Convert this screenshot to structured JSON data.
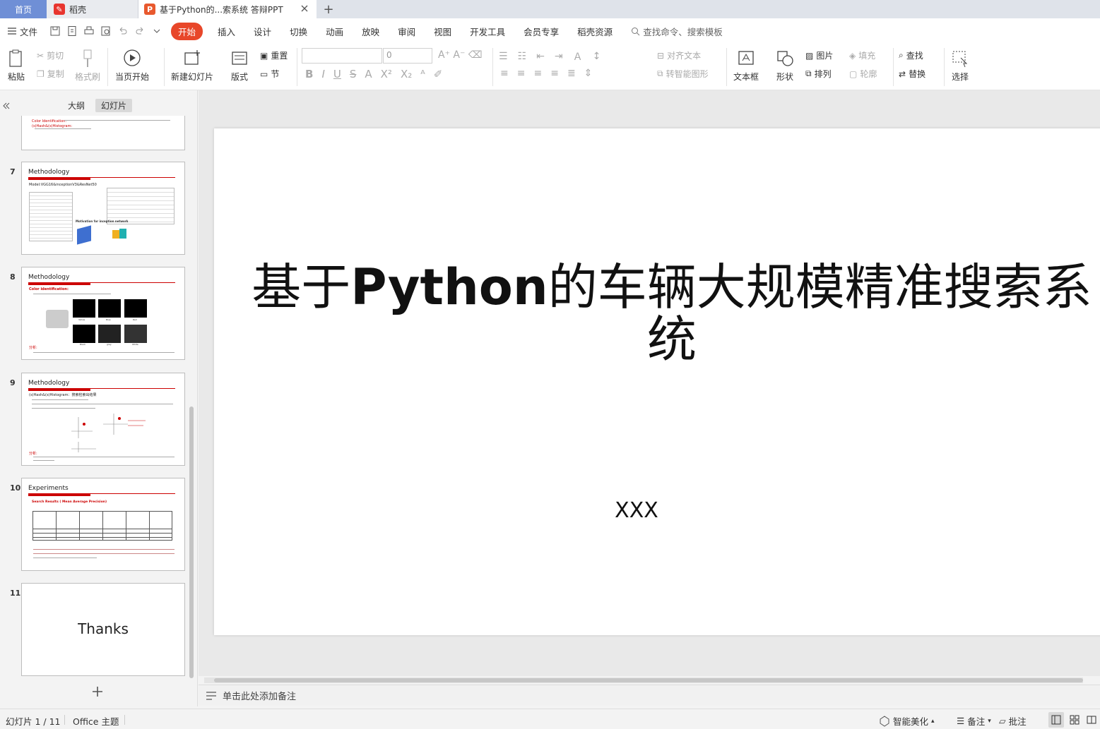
{
  "tabs": {
    "home": "首页",
    "docer": "稻壳",
    "file": "基于Python的...索系统 答辩PPT"
  },
  "menu": {
    "file": "文件",
    "items": [
      "开始",
      "插入",
      "设计",
      "切换",
      "动画",
      "放映",
      "审阅",
      "视图",
      "开发工具",
      "会员专享",
      "稻壳资源"
    ],
    "search": "查找命令、搜索模板"
  },
  "ribbon": {
    "paste": "粘贴",
    "cut": "剪切",
    "copy": "复制",
    "format_painter": "格式刷",
    "from_current": "当页开始",
    "new_slide": "新建幻灯片",
    "layout": "版式",
    "reset": "重置",
    "section": "节",
    "font_size": "0",
    "align_text": "对齐文本",
    "smart_art": "转智能图形",
    "textbox": "文本框",
    "shape": "形状",
    "picture": "图片",
    "arrange": "排列",
    "fill": "填充",
    "outline": "轮廓",
    "find": "查找",
    "replace": "替换",
    "select": "选择"
  },
  "panel": {
    "tab_outline": "大纲",
    "tab_slides": "幻灯片",
    "slides": [
      {
        "num": "7",
        "title": "Methodology",
        "line": "Model:VGG16&inceptionV3&ResNet50",
        "caption": "Motivation for inception network"
      },
      {
        "num": "8",
        "title": "Methodology",
        "line": "Color identification:",
        "labels": [
          "Yellow",
          "Blue",
          "Red",
          "Black",
          "grey",
          "White"
        ],
        "note_label": "分析:"
      },
      {
        "num": "9",
        "title": "Methodology",
        "line": "(s)Hash&(s)Histogram：搜索检索出结果",
        "note_label": "分析:"
      },
      {
        "num": "10",
        "title": "Experiments",
        "line": "Search Results ( Mean Average Precision)"
      },
      {
        "num": "11",
        "title": "Thanks"
      }
    ],
    "top_lines": [
      "Color Identification:",
      "(s)Hash&(s)Histogram:"
    ]
  },
  "slide": {
    "title_pre": "基于",
    "title_bold": "Python",
    "title_post": "的车辆大规模精准搜索系统",
    "subtitle": "XXX"
  },
  "notes": {
    "placeholder": "单击此处添加备注"
  },
  "status": {
    "slide_index": "幻灯片 1 / 11",
    "theme": "Office 主题",
    "beautify": "智能美化",
    "notes": "备注",
    "comments": "批注"
  },
  "colors": {
    "accent": "#e8472a",
    "home_tab": "#6f8fd6",
    "slide_red": "#c00000"
  }
}
